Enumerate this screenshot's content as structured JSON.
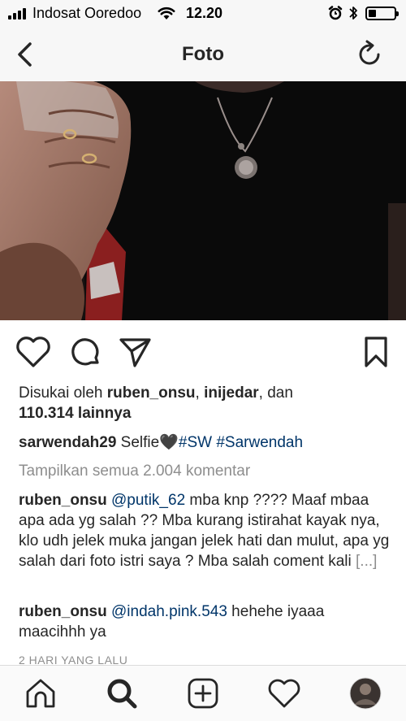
{
  "status_bar": {
    "carrier": "Indosat Ooredoo",
    "time": "12.20",
    "battery_level": 0.3
  },
  "nav": {
    "title": "Foto",
    "back_icon": "chevron-left-icon",
    "refresh_icon": "refresh-icon"
  },
  "post": {
    "likes": {
      "prefix": "Disukai oleh ",
      "user1": "ruben_onsu",
      "sep1": ", ",
      "user2": "inijedar",
      "sep2": ", dan",
      "count": "110.314 lainnya"
    },
    "caption": {
      "username": "sarwendah29",
      "text": " Selfie",
      "emoji": "🖤",
      "hashtag1": "#SW",
      "hashtag2": "#Sarwendah"
    },
    "view_all_comments": "Tampilkan semua 2.004 komentar",
    "comments": [
      {
        "username": "ruben_onsu",
        "mention": "@putik_62",
        "text": " mba knp ???? Maaf mbaa apa ada yg salah ?? Mba kurang istirahat kayak nya, klo udh jelek muka jangan jelek hati dan mulut, apa yg salah dari foto istri saya ? Mba salah coment kali ",
        "more": "[...]"
      },
      {
        "username": "ruben_onsu",
        "mention": "@indah.pink.543",
        "text": " hehehe iyaaa maacihhh ya"
      }
    ],
    "timestamp": "2 HARI YANG LALU"
  },
  "bottom_tabs": [
    "home-icon",
    "search-icon",
    "new-post-icon",
    "activity-heart-icon",
    "profile-avatar"
  ],
  "colors": {
    "text": "#262626",
    "hashtag": "#003569",
    "muted": "#8e8e8e",
    "bar_bg": "#f7f7f7"
  }
}
